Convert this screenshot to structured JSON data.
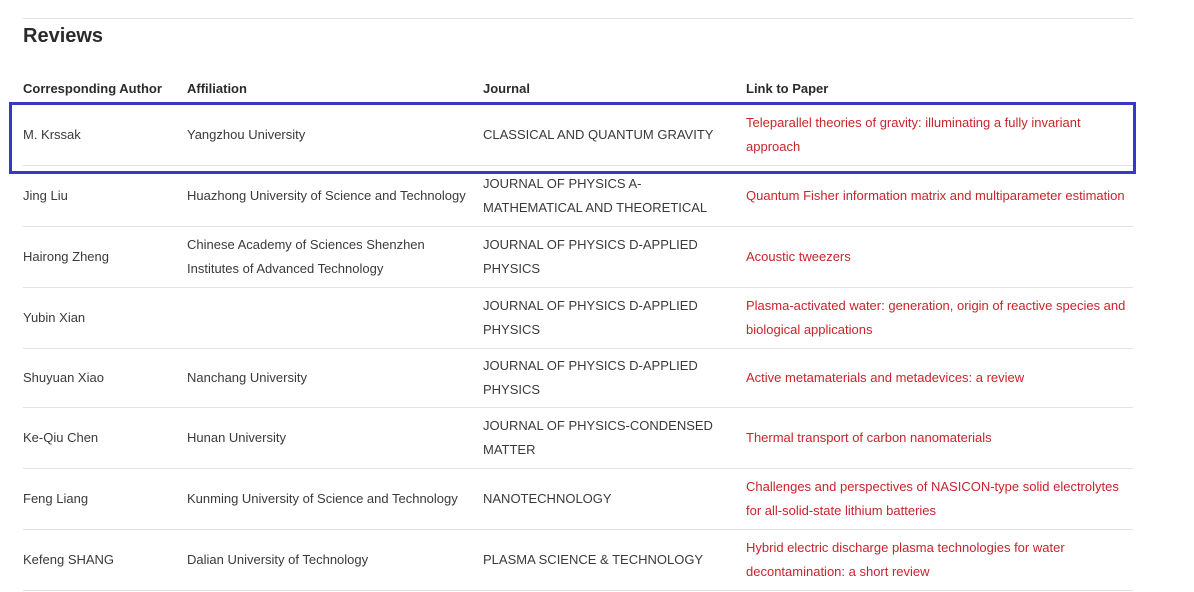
{
  "section": {
    "title": "Reviews"
  },
  "table": {
    "headers": [
      "Corresponding Author",
      "Affiliation",
      "Journal",
      "Link to Paper"
    ],
    "rows": [
      {
        "author": "M. Krssak",
        "affiliation": "Yangzhou University",
        "journal": "CLASSICAL AND QUANTUM GRAVITY",
        "paper": "Teleparallel theories of gravity: illuminating a fully invariant approach"
      },
      {
        "author": "Jing Liu",
        "affiliation": "Huazhong University of Science and Technology",
        "journal": "JOURNAL OF PHYSICS A-MATHEMATICAL AND THEORETICAL",
        "paper": "Quantum Fisher information matrix and multiparameter estimation"
      },
      {
        "author": "Hairong Zheng",
        "affiliation": "Chinese Academy of Sciences Shenzhen Institutes of Advanced Technology",
        "journal": "JOURNAL OF PHYSICS D-APPLIED PHYSICS",
        "paper": "Acoustic tweezers"
      },
      {
        "author": "Yubin Xian",
        "affiliation": "",
        "journal": "JOURNAL OF PHYSICS D-APPLIED PHYSICS",
        "paper": "Plasma-activated water: generation, origin of reactive species and biological applications"
      },
      {
        "author": "Shuyuan Xiao",
        "affiliation": "Nanchang University",
        "journal": "JOURNAL OF PHYSICS D-APPLIED PHYSICS",
        "paper": "Active metamaterials and metadevices: a review"
      },
      {
        "author": "Ke-Qiu Chen",
        "affiliation": "Hunan University",
        "journal": "JOURNAL OF PHYSICS-CONDENSED MATTER",
        "paper": "Thermal transport of carbon nanomaterials"
      },
      {
        "author": "Feng Liang",
        "affiliation": "Kunming University of Science and Technology",
        "journal": "NANOTECHNOLOGY",
        "paper": "Challenges and perspectives of NASICON-type solid electrolytes for all-solid-state lithium batteries"
      },
      {
        "author": "Kefeng SHANG",
        "affiliation": "Dalian University of Technology",
        "journal": "PLASMA SCIENCE & TECHNOLOGY",
        "paper": "Hybrid electric discharge plasma technologies for water decontamination: a short review"
      }
    ]
  },
  "colors": {
    "link": "#c8242b",
    "highlight_border": "#3838c7",
    "divider": "#e3e3e3"
  }
}
